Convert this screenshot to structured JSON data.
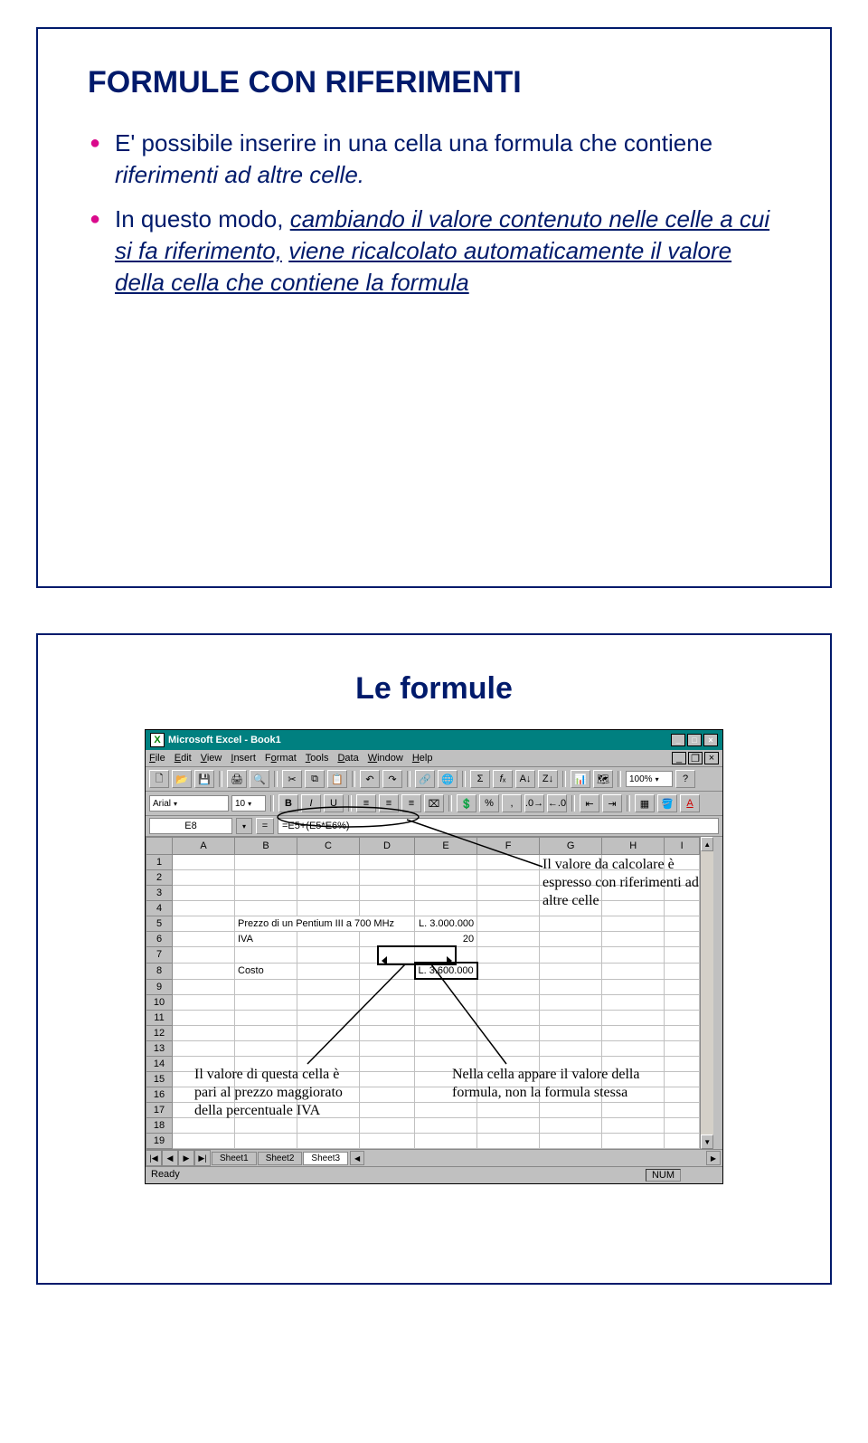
{
  "slide1": {
    "title": "FORMULE CON RIFERIMENTI",
    "bullet1_prefix": "E' possibile inserire in una cella una formula che contiene ",
    "bullet1_em": "riferimenti ad altre celle.",
    "bullet2_prefix": " In questo modo, ",
    "bullet2_u1": "cambiando il valore contenuto nelle celle a cui si fa riferimento,",
    "bullet2_mid": " ",
    "bullet2_u2": "viene ricalcolato automaticamente il valore della cella che contiene la formula"
  },
  "slide2": {
    "title": "Le formule",
    "excel": {
      "window_title": "Microsoft Excel - Book1",
      "menu": [
        "File",
        "Edit",
        "View",
        "Insert",
        "Format",
        "Tools",
        "Data",
        "Window",
        "Help"
      ],
      "font_name": "Arial",
      "font_size": "10",
      "zoom": "100%",
      "namebox": "E8",
      "formula": "=E5+(E5*E6%)",
      "columns": [
        "A",
        "B",
        "C",
        "D",
        "E",
        "F",
        "G",
        "H",
        "I"
      ],
      "row5_b": "Prezzo di un Pentium III a 700 MHz",
      "row5_e": "L. 3.000.000",
      "row6_b": "IVA",
      "row6_e": "20",
      "row8_b": "Costo",
      "row8_e": "L. 3.600.000",
      "tabs": [
        "Sheet1",
        "Sheet2",
        "Sheet3"
      ],
      "status_ready": "Ready",
      "status_num": "NUM"
    },
    "anno_topright": "Il valore da calcolare è espresso con riferimenti ad altre celle",
    "anno_bottomleft": "Il valore di questa cella è pari al prezzo maggiorato della percentuale IVA",
    "anno_bottomright": "Nella cella appare il valore della formula, non la formula stessa"
  }
}
